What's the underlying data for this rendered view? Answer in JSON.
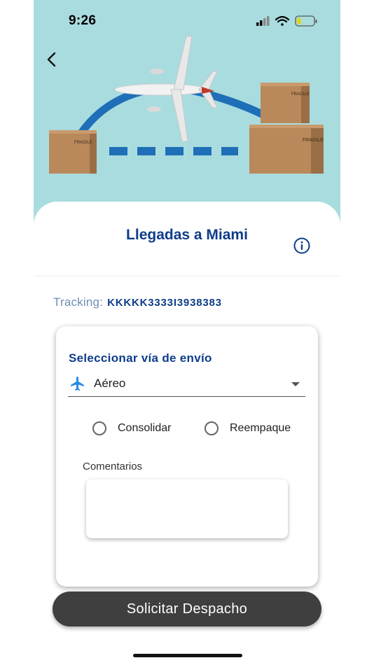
{
  "status_bar": {
    "time": "9:26"
  },
  "header": {
    "title": "Llegadas a Miami"
  },
  "tracking": {
    "label": "Tracking:",
    "value": "KKKKK3333I3938383"
  },
  "form": {
    "shipping_label": "Seleccionar vía de envío",
    "shipping_value": "Aéreo",
    "shipping_icon": "airplane-icon",
    "options": [
      {
        "label": "Consolidar",
        "selected": false
      },
      {
        "label": "Reempaque",
        "selected": false
      }
    ],
    "comments_label": "Comentarios",
    "comments_value": ""
  },
  "actions": {
    "submit_label": "Solicitar Despacho"
  },
  "colors": {
    "brand": "#0e3d8a",
    "accent_icon": "#2b8be6",
    "hero_bg": "#a9dcdf",
    "button": "#3f3f3f"
  }
}
